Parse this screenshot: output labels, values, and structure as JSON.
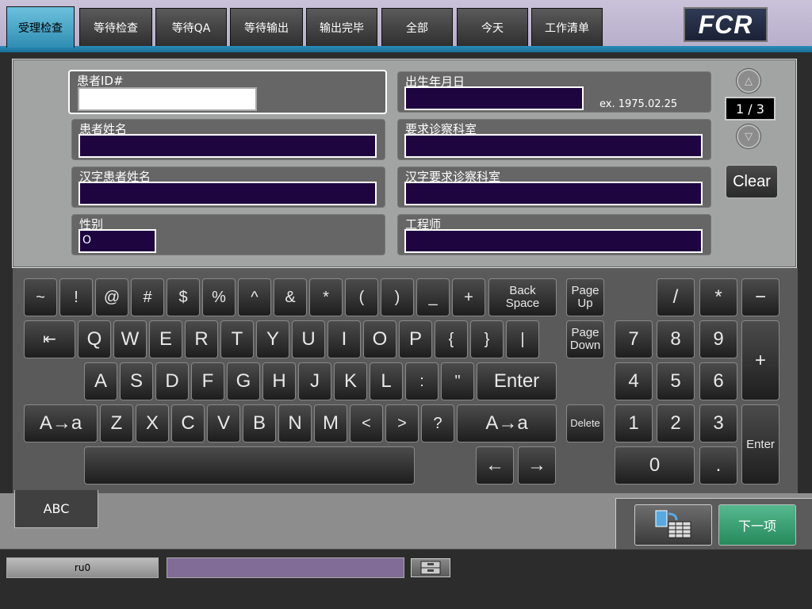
{
  "tabs": [
    {
      "label": "受理检查"
    },
    {
      "label": "等待检查"
    },
    {
      "label": "等待QA"
    },
    {
      "label": "等待输出"
    },
    {
      "label": "输出完毕"
    },
    {
      "label": "全部"
    },
    {
      "label": "今天"
    },
    {
      "label": "工作清单"
    }
  ],
  "logo": "FCR",
  "form": {
    "patient_id": {
      "label": "患者ID#",
      "value": ""
    },
    "birth_date": {
      "label": "出生年月日",
      "value": "",
      "hint": "ex. 1975.02.25"
    },
    "patient_name": {
      "label": "患者姓名",
      "value": ""
    },
    "department": {
      "label": "要求诊察科室",
      "value": ""
    },
    "kanji_name": {
      "label": "汉字患者姓名",
      "value": ""
    },
    "kanji_department": {
      "label": "汉字要求诊察科室",
      "value": ""
    },
    "sex": {
      "label": "性别",
      "value": "O"
    },
    "engineer": {
      "label": "工程师",
      "value": ""
    },
    "page_indicator": "1 / 3",
    "clear_label": "Clear"
  },
  "keyboard": {
    "row1": [
      "~",
      "!",
      "@",
      "#",
      "$",
      "%",
      "^",
      "&",
      "*",
      "(",
      ")",
      "_",
      "+"
    ],
    "backspace": [
      "Back",
      "Space"
    ],
    "tab": "⇤",
    "row2": [
      "Q",
      "W",
      "E",
      "R",
      "T",
      "Y",
      "U",
      "I",
      "O",
      "P",
      "{",
      "}",
      "|"
    ],
    "row3": [
      "A",
      "S",
      "D",
      "F",
      "G",
      "H",
      "J",
      "K",
      "L",
      ":",
      "\""
    ],
    "enter": "Enter",
    "shift": "A→a",
    "row4": [
      "Z",
      "X",
      "C",
      "V",
      "B",
      "N",
      "M",
      "<",
      ">",
      "?"
    ],
    "left_arrow": "←",
    "right_arrow": "→",
    "page_up": [
      "Page",
      "Up"
    ],
    "page_down": [
      "Page",
      "Down"
    ],
    "delete": "Delete",
    "numpad": {
      "ops": [
        "/",
        "*",
        "−"
      ],
      "r1": [
        "7",
        "8",
        "9"
      ],
      "r2": [
        "4",
        "5",
        "6"
      ],
      "r3": [
        "1",
        "2",
        "3"
      ],
      "plus": "+",
      "zero": "0",
      "dot": ".",
      "enter": "Enter"
    },
    "mode_label": "ABC"
  },
  "actions": {
    "next_label": "下一项"
  },
  "status": {
    "user": "ru0",
    "message": ""
  }
}
